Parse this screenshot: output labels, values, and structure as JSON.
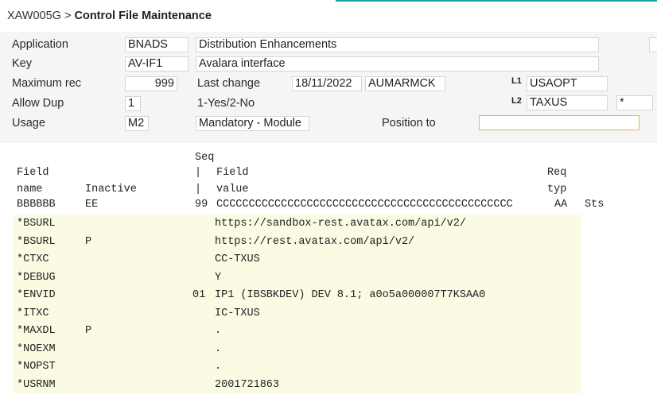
{
  "breadcrumb": {
    "code": "XAW005G",
    "separator": ">",
    "title": "Control File Maintenance"
  },
  "form": {
    "application_label": "Application",
    "application_code": "BNADS",
    "application_desc": "Distribution Enhancements",
    "key_label": "Key",
    "key_code": "AV-IF1",
    "key_desc": "Avalara interface",
    "maxrec_label": "Maximum rec",
    "maxrec_value": "999",
    "lastchange_label": "Last change",
    "lastchange_date": "18/11/2022",
    "lastchange_user": "AUMARMCK",
    "l1_label": "L1",
    "l1_value": "USAOPT",
    "allowdup_label": "Allow Dup",
    "allowdup_value": "1",
    "allowdup_hint": "1-Yes/2-No",
    "l2_label": "L2",
    "l2_value": "TAXUS",
    "l2_extra": "*",
    "usage_label": "Usage",
    "usage_code": "M2",
    "usage_desc": "Mandatory - Module",
    "position_label": "Position to",
    "position_value": ""
  },
  "grid": {
    "header": {
      "seq": "Seq",
      "field": "Field",
      "name": "name",
      "inactive": "Inactive",
      "pipe": "|",
      "field2": "Field",
      "value": "value",
      "req": "Req",
      "typ": "typ",
      "mask_name": "BBBBBB",
      "mask_inactive": "EE",
      "mask_seq": "99",
      "mask_value": "CCCCCCCCCCCCCCCCCCCCCCCCCCCCCCCCCCCCCCCCCCCCCC",
      "mask_req": "AA",
      "sts": "Sts"
    },
    "rows": [
      {
        "name": "*BSURL",
        "inactive": "",
        "seq": "",
        "value": "https://sandbox-rest.avatax.com/api/v2/"
      },
      {
        "name": "*BSURL",
        "inactive": "P",
        "seq": "",
        "value": "https://rest.avatax.com/api/v2/"
      },
      {
        "name": "*CTXC",
        "inactive": "",
        "seq": "",
        "value": "CC-TXUS"
      },
      {
        "name": "*DEBUG",
        "inactive": "",
        "seq": "",
        "value": "Y"
      },
      {
        "name": "*ENVID",
        "inactive": "",
        "seq": "01",
        "value": "IP1 (IBSBKDEV) DEV 8.1; a0o5a000007T7KSAA0"
      },
      {
        "name": "*ITXC",
        "inactive": "",
        "seq": "",
        "value": "IC-TXUS"
      },
      {
        "name": "*MAXDL",
        "inactive": "P",
        "seq": "",
        "value": "."
      },
      {
        "name": "*NOEXM",
        "inactive": "",
        "seq": "",
        "value": "."
      },
      {
        "name": "*NOPST",
        "inactive": "",
        "seq": "",
        "value": "."
      },
      {
        "name": "*USRNM",
        "inactive": "",
        "seq": "",
        "value": "2001721863"
      }
    ]
  },
  "colors": {
    "accent": "#1fa0a8",
    "row_bg": "#fbfbe4",
    "highlight_border": "#e8b740"
  }
}
